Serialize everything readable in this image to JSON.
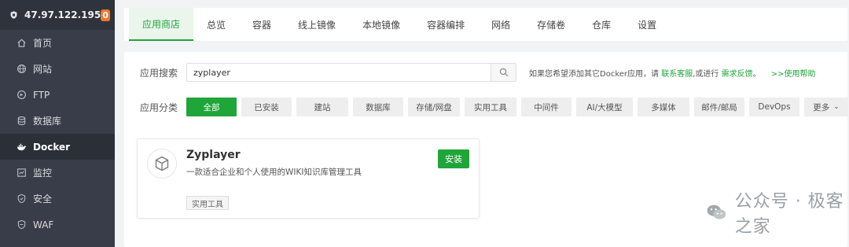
{
  "sidebar": {
    "server_ip": "47.97.122.195",
    "badge_count": "0",
    "items": [
      {
        "label": "首页",
        "icon": "home-icon"
      },
      {
        "label": "网站",
        "icon": "globe-icon"
      },
      {
        "label": "FTP",
        "icon": "ftp-icon"
      },
      {
        "label": "数据库",
        "icon": "database-icon"
      },
      {
        "label": "Docker",
        "icon": "docker-icon"
      },
      {
        "label": "监控",
        "icon": "monitor-icon"
      },
      {
        "label": "安全",
        "icon": "shield-icon"
      },
      {
        "label": "WAF",
        "icon": "waf-shield-icon"
      }
    ],
    "active_index": 4
  },
  "tabs": [
    "应用商店",
    "总览",
    "容器",
    "线上镜像",
    "本地镜像",
    "容器编排",
    "网络",
    "存储卷",
    "仓库",
    "设置"
  ],
  "active_tab": 0,
  "search": {
    "label": "应用搜索",
    "value": "zyplayer",
    "help_prefix": "如果您希望添加其它Docker应用，请",
    "help_link1": "联系客服",
    "help_mid": ",或进行",
    "help_link2": "需求反馈",
    "help_suffix": "。",
    "help_link3": ">>使用帮助"
  },
  "categories": {
    "label": "应用分类",
    "items": [
      "全部",
      "已安装",
      "建站",
      "数据库",
      "存储/网盘",
      "实用工具",
      "中间件",
      "AI/大模型",
      "多媒体",
      "邮件/邮局",
      "DevOps",
      "更多"
    ],
    "active_index": 0
  },
  "app_card": {
    "name": "Zyplayer",
    "description": "一款适合企业和个人使用的WIKI知识库管理工具",
    "tag": "实用工具",
    "install_label": "安装",
    "icon": "cube-icon"
  },
  "watermark": {
    "text": "公众号 · 极客之家",
    "icon": "wechat-icon"
  },
  "colors": {
    "accent": "#20a53a",
    "sidebar_bg": "#383d49",
    "badge": "#f0762c"
  }
}
